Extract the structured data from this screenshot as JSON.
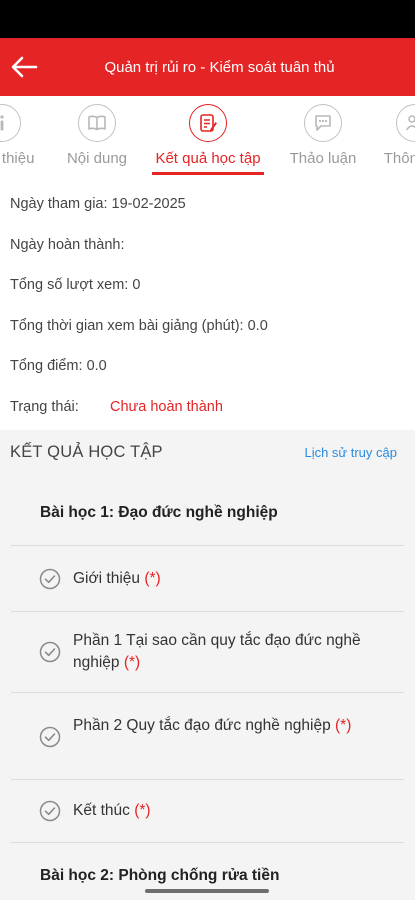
{
  "header": {
    "title": "Quản trị rủi ro - Kiểm soát tuân thủ"
  },
  "tabs": [
    {
      "label": "Giới thiệu",
      "icon": "info-icon"
    },
    {
      "label": "Nội dung",
      "icon": "book-icon"
    },
    {
      "label": "Kết quả học tập",
      "icon": "result-icon"
    },
    {
      "label": "Thảo luận",
      "icon": "chat-icon"
    },
    {
      "label": "Thông tin",
      "icon": "people-icon"
    }
  ],
  "info": {
    "join_date": "Ngày tham gia: 19-02-2025",
    "complete_date": "Ngày hoàn thành:",
    "views": "Tổng số lượt xem: 0",
    "watch_time": "Tổng thời gian xem bài giảng (phút): 0.0",
    "score": "Tổng điểm: 0.0",
    "status_label": "Trạng thái:",
    "status_value": "Chưa hoàn thành"
  },
  "results": {
    "title": "KẾT QUẢ HỌC TẬP",
    "history_link": "Lịch sử truy cập",
    "lesson1": {
      "title": "Bài học 1: Đạo đức nghề nghiệp",
      "items": [
        {
          "label": "Giới thiệu",
          "required": "(*)"
        },
        {
          "label": "Phần 1 Tại sao cần quy tắc đạo đức nghề nghiệp",
          "required": "(*)"
        },
        {
          "label": "Phần 2 Quy tắc đạo đức nghề nghiệp",
          "required": "(*)"
        },
        {
          "label": "Kết thúc",
          "required": "(*)"
        }
      ]
    },
    "lesson2": {
      "title": "Bài học 2: Phòng chống rửa tiền"
    }
  },
  "colors": {
    "brand": "#e52425",
    "link": "#2a8ce0"
  }
}
